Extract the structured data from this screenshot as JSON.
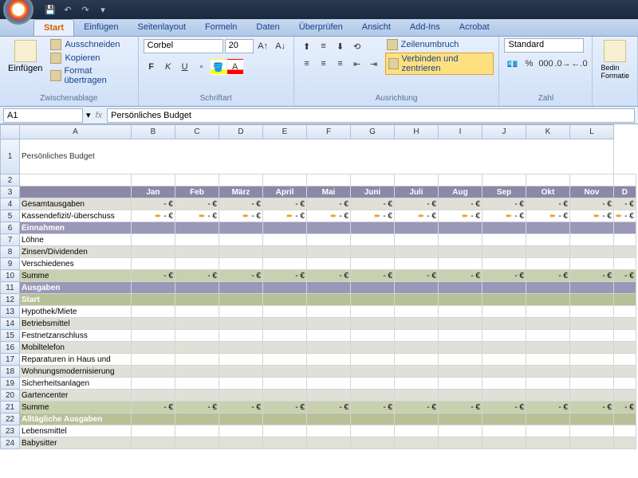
{
  "qat": {
    "save": "💾",
    "undo": "↶",
    "redo": "↷"
  },
  "tabs": [
    "Start",
    "Einfügen",
    "Seitenlayout",
    "Formeln",
    "Daten",
    "Überprüfen",
    "Ansicht",
    "Add-Ins",
    "Acrobat"
  ],
  "activeTab": 0,
  "ribbon": {
    "paste": "Einfügen",
    "cut": "Ausschneiden",
    "copy": "Kopieren",
    "formatPainter": "Format übertragen",
    "clipboard": "Zwischenablage",
    "fontName": "Corbel",
    "fontSize": "20",
    "fontGroup": "Schriftart",
    "alignGroup": "Ausrichtung",
    "wrapText": "Zeilenumbruch",
    "mergeCenter": "Verbinden und zentrieren",
    "numberFormat": "Standard",
    "numberGroup": "Zahl",
    "condFormat": "Bedin\nFormatie"
  },
  "nameBox": "A1",
  "formula": "Persönliches Budget",
  "cols": [
    "A",
    "B",
    "C",
    "D",
    "E",
    "F",
    "G",
    "H",
    "I",
    "J",
    "K",
    "L"
  ],
  "title": "Persönliches Budget",
  "months": [
    "Jan",
    "Feb",
    "März",
    "April",
    "Mai",
    "Juni",
    "Juli",
    "Aug",
    "Sep",
    "Okt",
    "Nov",
    "D"
  ],
  "rows": {
    "r4": "Gesamtausgaben",
    "r5": "Kassendefizit/-überschuss",
    "r6": "Einnahmen",
    "r7": "Löhne",
    "r8": "Zinsen/Dividenden",
    "r9": "Verschiedenes",
    "r10": "Summe",
    "r11": "Ausgaben",
    "r12": "Start",
    "r13": "Hypothek/Miete",
    "r14": "Betriebsmittel",
    "r15": "Festnetzanschluss",
    "r16": "Mobiltelefon",
    "r17": "Reparaturen in Haus und",
    "r18": "Wohnungsmodernisierung",
    "r19": "Sicherheitsanlagen",
    "r20": "Gartencenter",
    "r21": "Summe",
    "r22": "Alltägliche Ausgaben",
    "r23": "Lebensmittel",
    "r24": "Babysitter"
  },
  "euroVal": "- €"
}
